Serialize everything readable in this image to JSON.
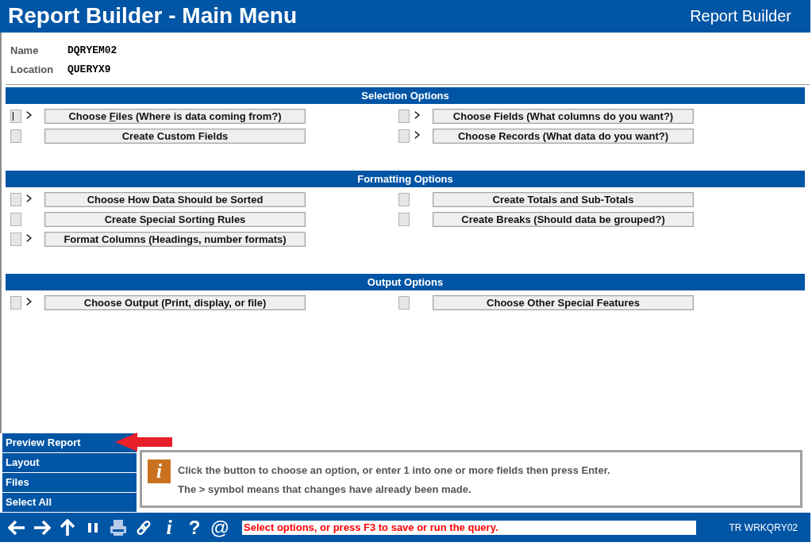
{
  "window": {
    "title": "Report Builder - Main Menu",
    "app_name": "Report Builder"
  },
  "query": [
    {
      "label": "Name",
      "value": "DQRYEM02"
    },
    {
      "label": "Location",
      "value": "QUERYX9"
    }
  ],
  "sections": [
    {
      "title": "Selection Options",
      "options": [
        {
          "label_parts": [
            "Choose ",
            "F",
            "iles (Where is data coming from?)"
          ],
          "changed": true,
          "focused": true
        },
        {
          "label": "Choose Fields (What columns do you want?)",
          "changed": true,
          "focused": false
        },
        {
          "label": "Create Custom Fields",
          "changed": false,
          "focused": false
        },
        {
          "label": "Choose Records (What data do you want?)",
          "changed": true,
          "focused": false
        }
      ]
    },
    {
      "title": "Formatting Options",
      "options": [
        {
          "label": "Choose How Data Should be Sorted",
          "changed": true,
          "focused": false
        },
        {
          "label": "Create Totals and Sub-Totals",
          "changed": false,
          "focused": false
        },
        {
          "label": "Create Special Sorting Rules",
          "changed": false,
          "focused": false
        },
        {
          "label": "Create Breaks (Should data be grouped?)",
          "changed": false,
          "focused": false
        },
        {
          "label": "Format Columns (Headings, number formats)",
          "changed": true,
          "focused": false
        }
      ]
    },
    {
      "title": "Output Options",
      "options": [
        {
          "label": "Choose Output (Print, display, or file)",
          "changed": true,
          "focused": false
        },
        {
          "label": "Choose Other Special Features",
          "changed": false,
          "focused": false
        }
      ]
    }
  ],
  "side_menu": [
    {
      "label": "Preview Report",
      "pointed_at": true
    },
    {
      "label": "Layout",
      "pointed_at": false
    },
    {
      "label": "Files",
      "pointed_at": false
    },
    {
      "label": "Select All",
      "pointed_at": false
    }
  ],
  "info": {
    "icon": "i",
    "lines": [
      "Click the button to choose an option, or enter 1 into one or more fields then press Enter.",
      "The > symbol means that changes have already been made."
    ]
  },
  "toolbar": {
    "buttons": [
      {
        "kind": "back"
      },
      {
        "kind": "forward"
      },
      {
        "kind": "up"
      },
      {
        "kind": "pause"
      },
      {
        "kind": "print"
      },
      {
        "kind": "link"
      },
      {
        "kind": "info",
        "symbol": "i"
      },
      {
        "kind": "help",
        "symbol": "?"
      },
      {
        "kind": "at",
        "symbol": "@"
      }
    ],
    "message": "Select options, or press F3 to save or run the query.",
    "screen_id": "TR WRKQRY02"
  }
}
